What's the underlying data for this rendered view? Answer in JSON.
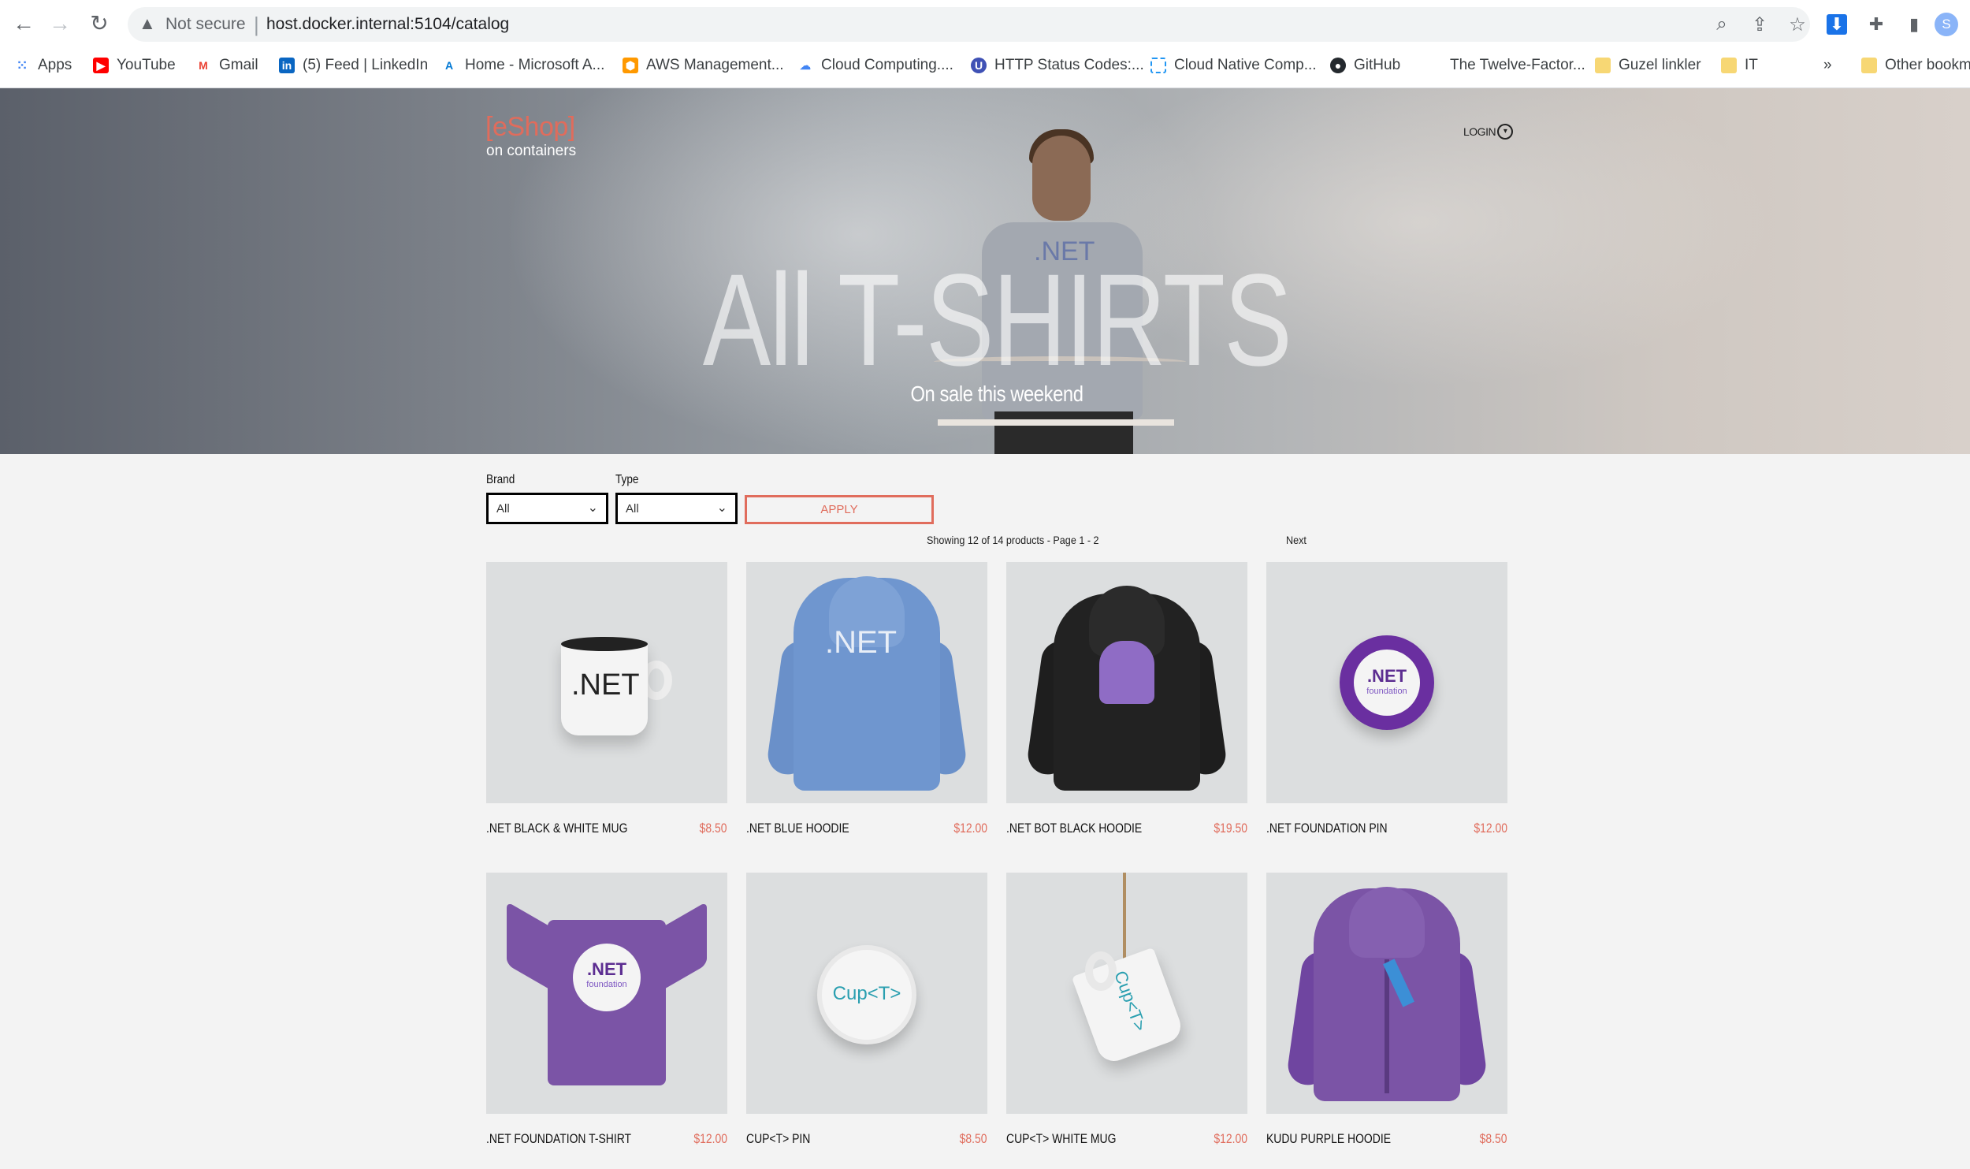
{
  "browser": {
    "url_warning": "Not secure",
    "url": "host.docker.internal:5104/catalog",
    "profile_initial": "S",
    "bookmarks": [
      {
        "label": "Apps",
        "icon": "apps-grid-icon",
        "color": "#4285f4"
      },
      {
        "label": "YouTube",
        "icon": "youtube-icon",
        "color": "#ff0000"
      },
      {
        "label": "Gmail",
        "icon": "gmail-icon",
        "color": "#ea4335"
      },
      {
        "label": "(5) Feed | LinkedIn",
        "icon": "linkedin-icon",
        "color": "#0a66c2"
      },
      {
        "label": "Home - Microsoft A...",
        "icon": "azure-icon",
        "color": "#0078d4"
      },
      {
        "label": "AWS Management...",
        "icon": "aws-icon",
        "color": "#ff9900"
      },
      {
        "label": "Cloud Computing....",
        "icon": "google-cloud-icon",
        "color": "#4285f4"
      },
      {
        "label": "HTTP Status Codes:...",
        "icon": "http-status-icon",
        "color": "#3f51b5"
      },
      {
        "label": "Cloud Native Comp...",
        "icon": "cncf-icon",
        "color": "#2196f3"
      },
      {
        "label": "GitHub",
        "icon": "github-icon",
        "color": "#24292e"
      },
      {
        "label": "The Twelve-Factor...",
        "icon": "twelve-factor-icon",
        "color": "#ffffff"
      },
      {
        "label": "Guzel linkler",
        "icon": "folder-icon",
        "color": "#f7d774"
      },
      {
        "label": "IT",
        "icon": "folder-icon",
        "color": "#f7d774"
      },
      {
        "label": "Other bookm",
        "icon": "folder-icon",
        "color": "#f7d774"
      }
    ],
    "overflow_label": "»"
  },
  "header": {
    "logo": "[eShop]",
    "logo_sub": "on containers",
    "login_label": "LOGIN"
  },
  "hero": {
    "title": "All T-SHIRTS",
    "subtitle": "On sale this weekend",
    "shirt_print": ".NET"
  },
  "filters": {
    "brand_label": "Brand",
    "brand_value": "All",
    "type_label": "Type",
    "type_value": "All",
    "apply_label": "APPLY"
  },
  "paging": {
    "status": "Showing 12 of 14 products - Page 1 - 2",
    "next_label": "Next"
  },
  "products": [
    {
      "name": ".NET BLACK & WHITE MUG",
      "price": "$8.50",
      "art_text": ".NET"
    },
    {
      "name": ".NET BLUE HOODIE",
      "price": "$12.00",
      "art_text": ".NET"
    },
    {
      "name": ".NET BOT BLACK HOODIE",
      "price": "$19.50",
      "art_text": ""
    },
    {
      "name": ".NET FOUNDATION PIN",
      "price": "$12.00",
      "art_text": ".NET",
      "art_sub": "foundation"
    },
    {
      "name": ".NET FOUNDATION T-SHIRT",
      "price": "$12.00",
      "art_text": ".NET",
      "art_sub": "foundation"
    },
    {
      "name": "CUP<T> PIN",
      "price": "$8.50",
      "art_text": "Cup<T>"
    },
    {
      "name": "CUP<T> WHITE MUG",
      "price": "$12.00",
      "art_text": "Cup<T>"
    },
    {
      "name": "KUDU PURPLE HOODIE",
      "price": "$8.50",
      "art_text": ""
    }
  ],
  "colors": {
    "accent": "#e06c5c",
    "background": "#f3f3f3",
    "product_bg": "#dcdedf",
    "blue_hoodie": "#6f96cf",
    "black_hoodie": "#222222",
    "purple": "#7b54a6"
  }
}
